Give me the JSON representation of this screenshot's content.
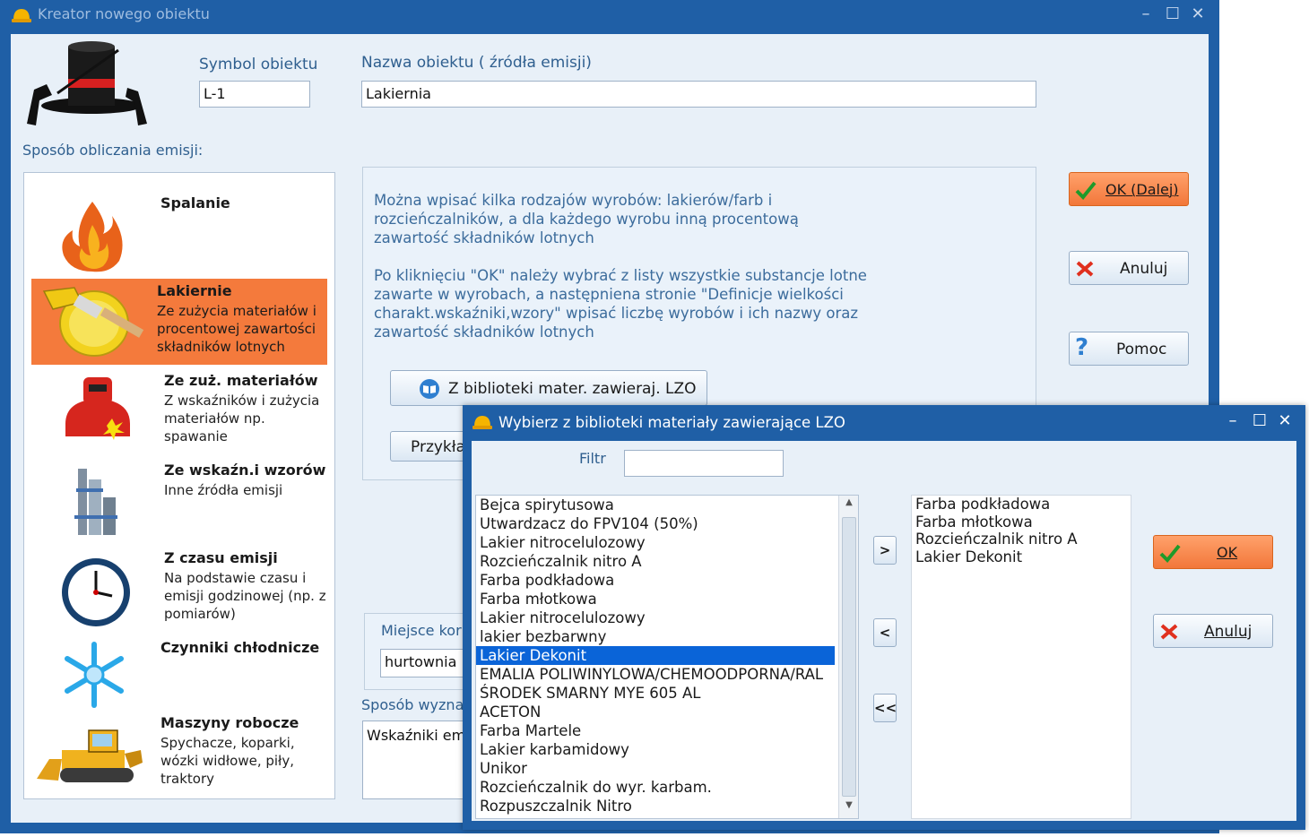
{
  "main_window": {
    "title": "Kreator nowego obiektu",
    "symbol_label": "Symbol obiektu",
    "symbol_value": "L-1",
    "name_label": "Nazwa obiektu ( źródła emisji)",
    "name_value": "Lakiernia",
    "method_label": "Sposób obliczania emisji:",
    "methods": [
      {
        "title": "Spalanie",
        "desc": ""
      },
      {
        "title": "Lakiernie",
        "desc": "Ze zużycia materiałów i procentowej zawartości składników lotnych"
      },
      {
        "title": "Ze zuż. materiałów",
        "desc": "Z wskaźników i zużycia materiałów np. spawanie"
      },
      {
        "title": "Ze wskaźn.i wzorów",
        "desc": "Inne źródła emisji"
      },
      {
        "title": "Z czasu emisji",
        "desc": "Na podstawie czasu i emisji godzinowej  (np. z pomiarów)"
      },
      {
        "title": "Czynniki chłodnicze",
        "desc": ""
      },
      {
        "title": "Maszyny robocze",
        "desc": "Spychacze, koparki, wózki widłowe, piły, traktory"
      }
    ],
    "info_lines_1": [
      "Można wpisać kilka rodzajów wyrobów: lakierów/farb i",
      "rozcieńczalników, a dla każdego wyrobu inną procentową",
      "zawartość składników lotnych"
    ],
    "info_lines_2": [
      "Po kliknięciu \"OK\" należy wybrać z listy wszystkie substancje lotne",
      "zawarte w wyrobach, a następniena stronie \"Definicje wielkości",
      "charakt.wskaźniki,wzory\" wpisać liczbę wyrobów i ich nazwy oraz",
      "zawartość składników lotnych"
    ],
    "library_button": "Z biblioteki mater. zawieraj. LZO",
    "example_button": "Przykład",
    "place_label": "Miejsce kor",
    "place_value": "hurtownia",
    "method_detail_label": "Sposób wyzna",
    "method_detail_value": "Wskaźniki em",
    "ok_button": "OK (Dalej)",
    "cancel_button": "Anuluj",
    "help_button": "Pomoc"
  },
  "dialog": {
    "title": "Wybierz z biblioteki materiały zawierające LZO",
    "filter_label": "Filtr",
    "filter_value": "",
    "available": [
      "Bejca spirytusowa",
      "Utwardzacz do FPV104 (50%)",
      "Lakier nitrocelulozowy",
      "Rozcieńczalnik nitro A",
      "Farba podkładowa",
      "Farba młotkowa",
      "Lakier nitrocelulozowy",
      "lakier bezbarwny",
      "Lakier Dekonit",
      "EMALIA POLIWINYLOWA/CHEMOODPORNA/RAL",
      "ŚRODEK SMARNY MYE 605 AL",
      "ACETON",
      "Farba Martele",
      "Lakier karbamidowy",
      "Unikor",
      "Rozcieńczalnik do wyr. karbam.",
      "Rozpuszczalnik Nitro"
    ],
    "selected_index": 8,
    "chosen": [
      "Farba podkładowa",
      "Farba młotkowa",
      "Rozcieńczalnik nitro A",
      "Lakier Dekonit"
    ],
    "add_button": ">",
    "remove_button": "<",
    "remove_all_button": "<<",
    "ok_button": "OK",
    "cancel_button": "Anuluj"
  },
  "colors": {
    "title_bar": "#1f5fa6",
    "client_bg": "#e8f0f8",
    "accent_orange": "#f47a3c",
    "selection_blue": "#0a64d8"
  }
}
